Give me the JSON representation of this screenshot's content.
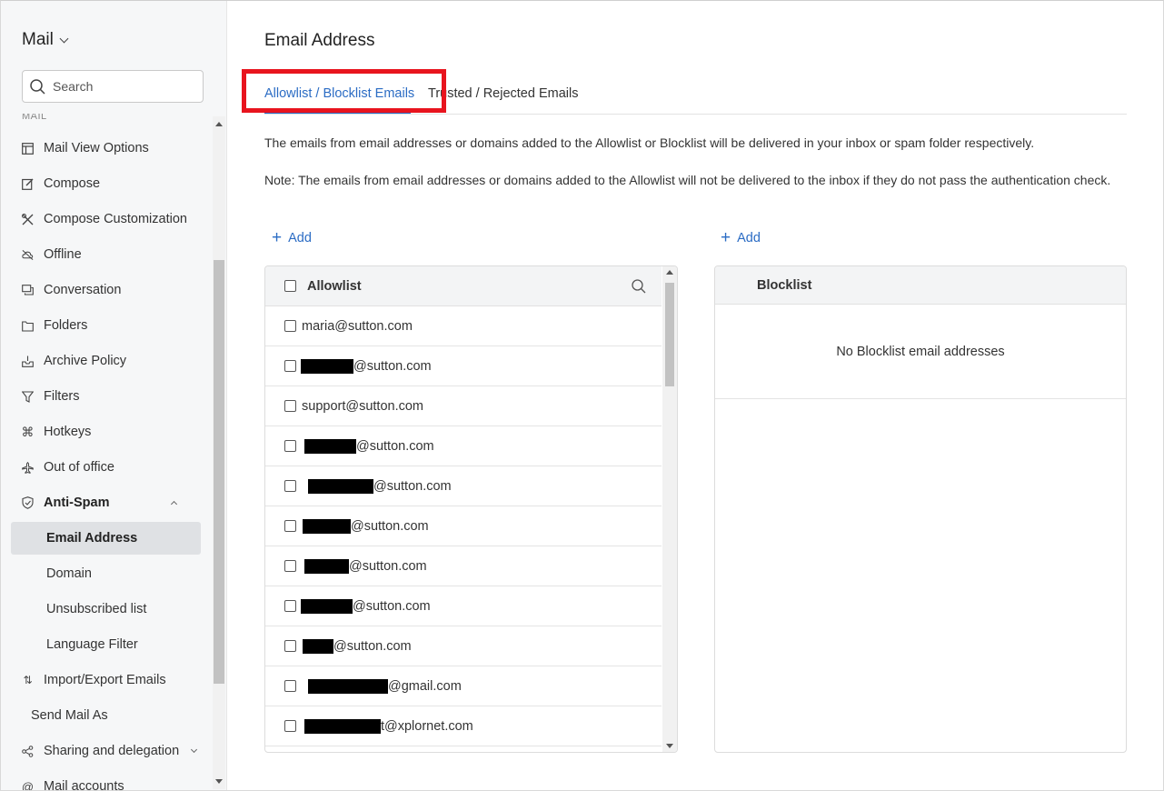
{
  "sidebar": {
    "app_title": "Mail",
    "search_placeholder": "Search",
    "section_label": "MAIL",
    "items": [
      {
        "label": "Mail View Options",
        "icon": "layout-icon"
      },
      {
        "label": "Compose",
        "icon": "edit-icon"
      },
      {
        "label": "Compose Customization",
        "icon": "tools-icon"
      },
      {
        "label": "Offline",
        "icon": "cloud-off-icon"
      },
      {
        "label": "Conversation",
        "icon": "chat-icon"
      },
      {
        "label": "Folders",
        "icon": "folder-icon"
      },
      {
        "label": "Archive Policy",
        "icon": "archive-icon"
      },
      {
        "label": "Filters",
        "icon": "filter-icon"
      },
      {
        "label": "Hotkeys",
        "icon": "command-icon"
      },
      {
        "label": "Out of office",
        "icon": "plane-icon"
      },
      {
        "label": "Anti-Spam",
        "icon": "shield-icon"
      }
    ],
    "anti_spam_sub": [
      "Email Address",
      "Domain",
      "Unsubscribed list",
      "Language Filter"
    ],
    "after_items": [
      {
        "label": "Import/Export Emails",
        "icon": "import-export-icon"
      },
      {
        "label": "Send Mail As",
        "icon": ""
      },
      {
        "label": "Sharing and delegation",
        "icon": "share-icon"
      },
      {
        "label": "Mail accounts",
        "icon": "at-icon"
      }
    ]
  },
  "main": {
    "title": "Email Address",
    "tabs": [
      "Allowlist / Blocklist Emails",
      "Trusted / Rejected Emails"
    ],
    "description": "The emails from email addresses or domains added to the Allowlist or Blocklist will be delivered in your inbox or spam folder respectively.",
    "note": "Note: The emails from email addresses or domains added to the Allowlist will not be delivered to the inbox if they do not pass the authentication check.",
    "add_label": "Add",
    "allowlist": {
      "header": "Allowlist",
      "rows": [
        {
          "prefix": "maria",
          "domain": "@sutton.com"
        },
        {
          "prefix": "",
          "domain": "@sutton.com"
        },
        {
          "prefix": "support",
          "domain": "@sutton.com"
        },
        {
          "prefix": "",
          "domain": "@sutton.com"
        },
        {
          "prefix": "",
          "domain": "@sutton.com"
        },
        {
          "prefix": "",
          "domain": "@sutton.com"
        },
        {
          "prefix": "",
          "domain": "@sutton.com"
        },
        {
          "prefix": "",
          "domain": "@sutton.com"
        },
        {
          "prefix": "",
          "domain": "@sutton.com"
        },
        {
          "prefix": "",
          "domain": "@gmail.com"
        },
        {
          "prefix": "",
          "domain": "t@xplornet.com"
        }
      ]
    },
    "blocklist": {
      "header": "Blocklist",
      "empty_text": "No Blocklist email addresses"
    }
  },
  "colors": {
    "accent": "#2b6cc4",
    "highlight": "#e8141e",
    "sidebar_bg": "#f6f7f8",
    "active_item_bg": "#dfe1e4"
  }
}
